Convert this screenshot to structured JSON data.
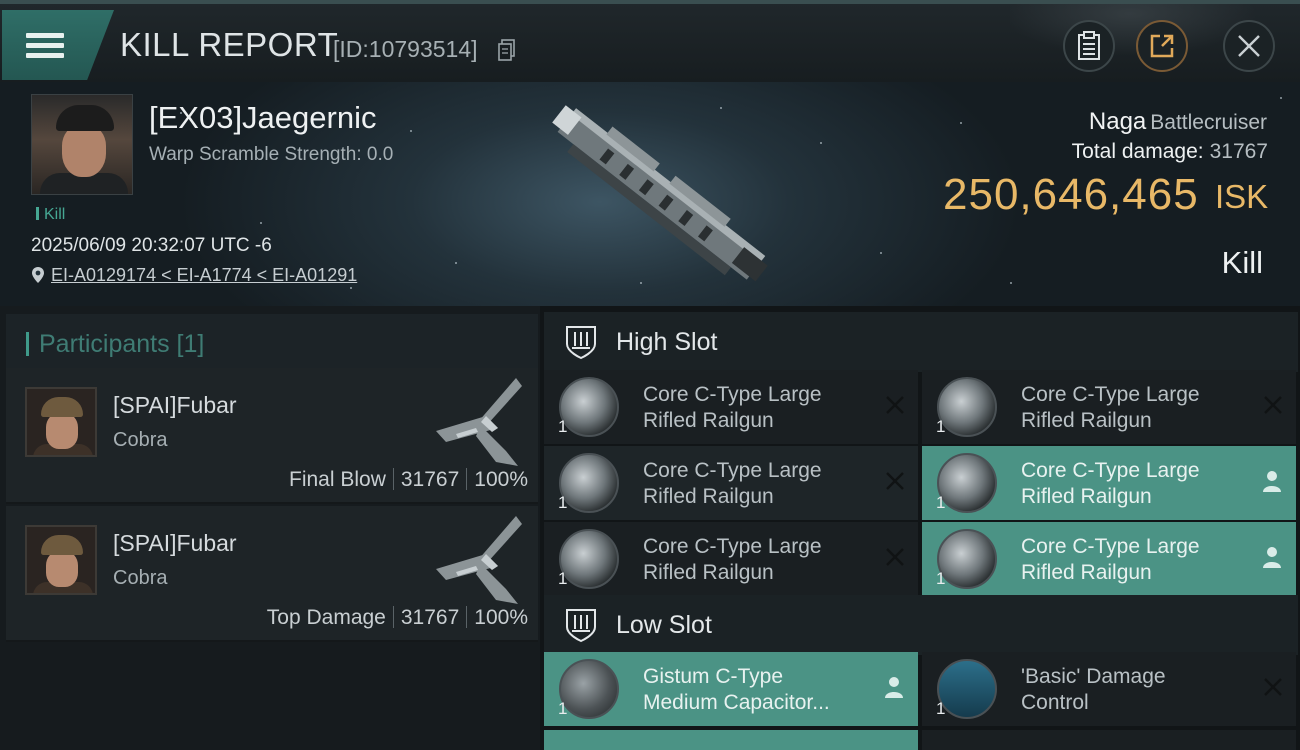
{
  "header": {
    "title": "KILL REPORT",
    "report_id": "[ID:10793514]",
    "icons": [
      "menu-icon",
      "copy-icon",
      "clipboard-icon",
      "share-icon",
      "close-icon"
    ]
  },
  "victim": {
    "name": "[EX03]Jaegernic",
    "warp_scramble": "Warp Scramble Strength: 0.0",
    "tag": "Kill",
    "timestamp": "2025/06/09 20:32:07 UTC -6",
    "location": "EI-A0129174 < EI-A1774 < EI-A01291",
    "ship_name": "Naga",
    "ship_class": "Battlecruiser",
    "total_damage_label": "Total damage:",
    "total_damage": "31767",
    "isk_value": "250,646,465",
    "isk_unit": "ISK",
    "result": "Kill"
  },
  "participants": {
    "header": "Participants [1]",
    "rows": [
      {
        "name": "[SPAI]Fubar",
        "ship": "Cobra",
        "role": "Final Blow",
        "damage": "31767",
        "percent": "100%"
      },
      {
        "name": "[SPAI]Fubar",
        "ship": "Cobra",
        "role": "Top Damage",
        "damage": "31767",
        "percent": "100%"
      }
    ]
  },
  "slots": {
    "high": {
      "label": "High Slot",
      "modules": [
        {
          "line1": "Core C-Type Large",
          "line2": "Rifled Railgun",
          "qty": "1",
          "status": "destroyed"
        },
        {
          "line1": "Core C-Type Large",
          "line2": "Rifled Railgun",
          "qty": "1",
          "status": "destroyed"
        },
        {
          "line1": "Core C-Type Large",
          "line2": "Rifled Railgun",
          "qty": "1",
          "status": "destroyed"
        },
        {
          "line1": "Core C-Type Large",
          "line2": "Rifled Railgun",
          "qty": "1",
          "status": "dropped"
        },
        {
          "line1": "Core C-Type Large",
          "line2": "Rifled Railgun",
          "qty": "1",
          "status": "destroyed"
        },
        {
          "line1": "Core C-Type Large",
          "line2": "Rifled Railgun",
          "qty": "1",
          "status": "dropped"
        }
      ]
    },
    "low": {
      "label": "Low Slot",
      "modules": [
        {
          "line1": "Gistum C-Type",
          "line2": "Medium Capacitor...",
          "qty": "1",
          "status": "dropped"
        },
        {
          "line1": "'Basic' Damage",
          "line2": "Control",
          "qty": "1",
          "status": "destroyed"
        }
      ]
    }
  },
  "colors": {
    "accent_teal": "#4b9385",
    "isk_gold": "#e8b867",
    "menu_teal": "#2f6e67"
  }
}
